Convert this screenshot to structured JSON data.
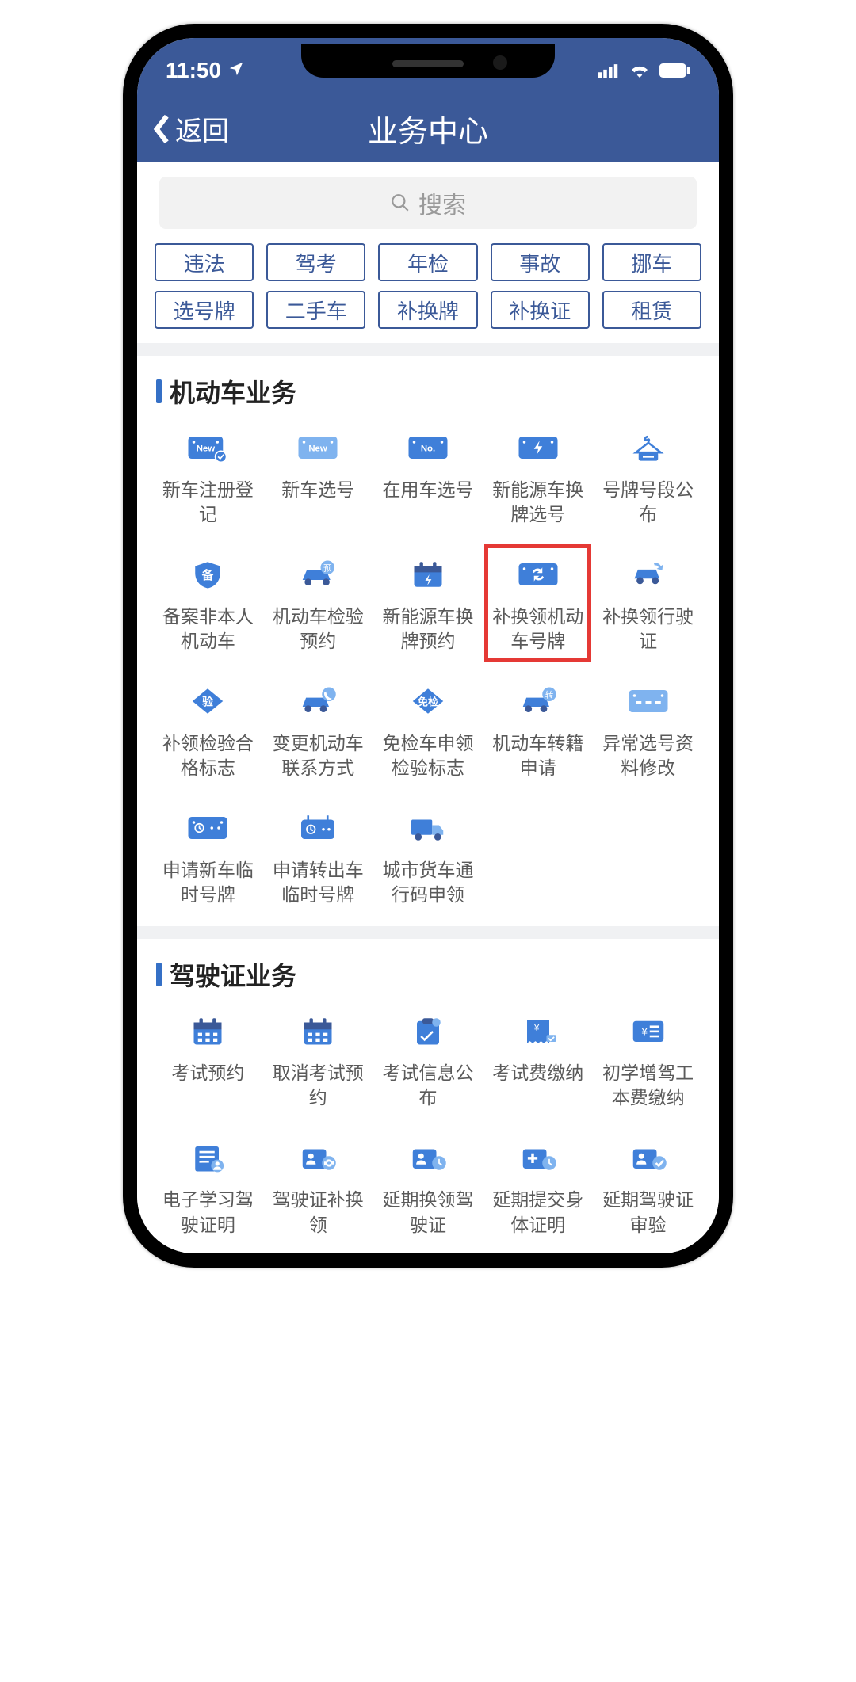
{
  "status": {
    "time": "11:50"
  },
  "nav": {
    "back": "返回",
    "title": "业务中心"
  },
  "search": {
    "placeholder": "搜索"
  },
  "tags": [
    "违法",
    "驾考",
    "年检",
    "事故",
    "挪车",
    "选号牌",
    "二手车",
    "补换牌",
    "补换证",
    "租赁"
  ],
  "sections": [
    {
      "title": "机动车业务",
      "items": [
        {
          "name": "new-car-register",
          "label": "新车注册登记",
          "icon": "plate-newcheck"
        },
        {
          "name": "new-car-select",
          "label": "新车选号",
          "icon": "plate-new"
        },
        {
          "name": "inuse-car-select",
          "label": "在用车选号",
          "icon": "plate-no"
        },
        {
          "name": "newenergy-replate",
          "label": "新能源车换牌选号",
          "icon": "plate-bolt"
        },
        {
          "name": "plate-segment",
          "label": "号牌号段公布",
          "icon": "hanger"
        },
        {
          "name": "record-other",
          "label": "备案非本人机动车",
          "icon": "shield-bei"
        },
        {
          "name": "inspect-reserve",
          "label": "机动车检验预约",
          "icon": "car-yu"
        },
        {
          "name": "newenergy-reserve",
          "label": "新能源车换牌预约",
          "icon": "calendar-bolt"
        },
        {
          "name": "replace-plate",
          "label": "补换领机动车号牌",
          "icon": "plate-cycle",
          "highlight": true
        },
        {
          "name": "replace-license",
          "label": "补换领行驶证",
          "icon": "car-cycle"
        },
        {
          "name": "replace-inspect",
          "label": "补领检验合格标志",
          "icon": "diamond-yan"
        },
        {
          "name": "change-contact",
          "label": "变更机动车联系方式",
          "icon": "car-phone"
        },
        {
          "name": "exempt-inspect",
          "label": "免检车申领检验标志",
          "icon": "diamond-mian"
        },
        {
          "name": "transfer-apply",
          "label": "机动车转籍申请",
          "icon": "car-zhuan"
        },
        {
          "name": "abnormal-select",
          "label": "异常选号资料修改",
          "icon": "plate-dotdot"
        },
        {
          "name": "temp-plate-new",
          "label": "申请新车临时号牌",
          "icon": "plate-clock"
        },
        {
          "name": "temp-plate-out",
          "label": "申请转出车临时号牌",
          "icon": "radio-clock"
        },
        {
          "name": "truck-pass",
          "label": "城市货车通行码申领",
          "icon": "truck"
        }
      ]
    },
    {
      "title": "驾驶证业务",
      "items": [
        {
          "name": "exam-reserve",
          "label": "考试预约",
          "icon": "calendar"
        },
        {
          "name": "exam-cancel",
          "label": "取消考试预约",
          "icon": "calendar"
        },
        {
          "name": "exam-info",
          "label": "考试信息公布",
          "icon": "clipboard"
        },
        {
          "name": "exam-fee",
          "label": "考试费缴纳",
          "icon": "receipt"
        },
        {
          "name": "add-class-fee",
          "label": "初学增驾工本费缴纳",
          "icon": "fee-lines"
        },
        {
          "name": "e-learning",
          "label": "电子学习驾驶证明",
          "icon": "doc-user"
        },
        {
          "name": "license-replace",
          "label": "驾驶证补换领",
          "icon": "person-cycle"
        },
        {
          "name": "delay-renew",
          "label": "延期换领驾驶证",
          "icon": "person-clock"
        },
        {
          "name": "delay-body",
          "label": "延期提交身体证明",
          "icon": "plus-clock"
        },
        {
          "name": "delay-audit",
          "label": "延期驾驶证审验",
          "icon": "person-check"
        }
      ]
    }
  ]
}
